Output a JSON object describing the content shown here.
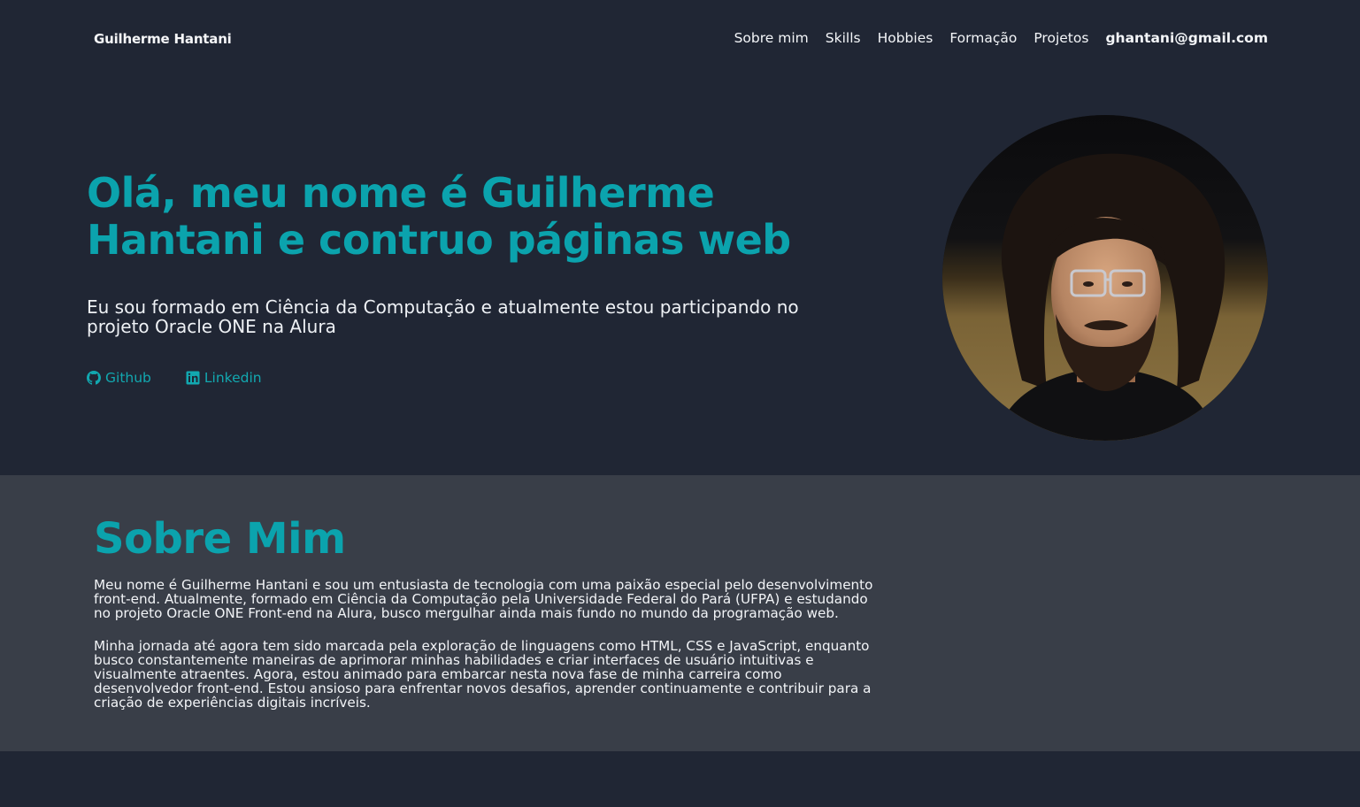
{
  "header": {
    "brand": "Guilherme Hantani",
    "nav": [
      {
        "label": "Sobre mim"
      },
      {
        "label": "Skills"
      },
      {
        "label": "Hobbies"
      },
      {
        "label": "Formação"
      },
      {
        "label": "Projetos"
      },
      {
        "label": "ghantani@gmail.com"
      }
    ]
  },
  "hero": {
    "title": "Olá, meu nome é Guilherme Hantani e contruo páginas web",
    "subtitle": "Eu sou formado em Ciência da Computação e atualmente estou participando no projeto Oracle ONE na Alura",
    "links": [
      {
        "label": "Github",
        "icon": "github-icon"
      },
      {
        "label": "Linkedin",
        "icon": "linkedin-icon"
      }
    ]
  },
  "about": {
    "title": "Sobre Mim",
    "paragraphs": [
      "Meu nome é Guilherme Hantani e sou um entusiasta de tecnologia com uma paixão especial pelo desenvolvimento front-end. Atualmente, formado em Ciência da Computação pela Universidade Federal do Pará (UFPA) e estudando no projeto Oracle ONE Front-end na Alura, busco mergulhar ainda mais fundo no mundo da programação web.",
      "Minha jornada até agora tem sido marcada pela exploração de linguagens como HTML, CSS e JavaScript, enquanto busco constantemente maneiras de aprimorar minhas habilidades e criar interfaces de usuário intuitivas e visualmente atraentes. Agora, estou animado para embarcar nesta nova fase de minha carreira como desenvolvedor front-end. Estou ansioso para enfrentar novos desafios, aprender continuamente e contribuir para a criação de experiências digitais incríveis."
    ]
  },
  "colors": {
    "background": "#202634",
    "section": "#393e48",
    "accent": "#0ba3ad",
    "text": "#f2f4f7"
  }
}
